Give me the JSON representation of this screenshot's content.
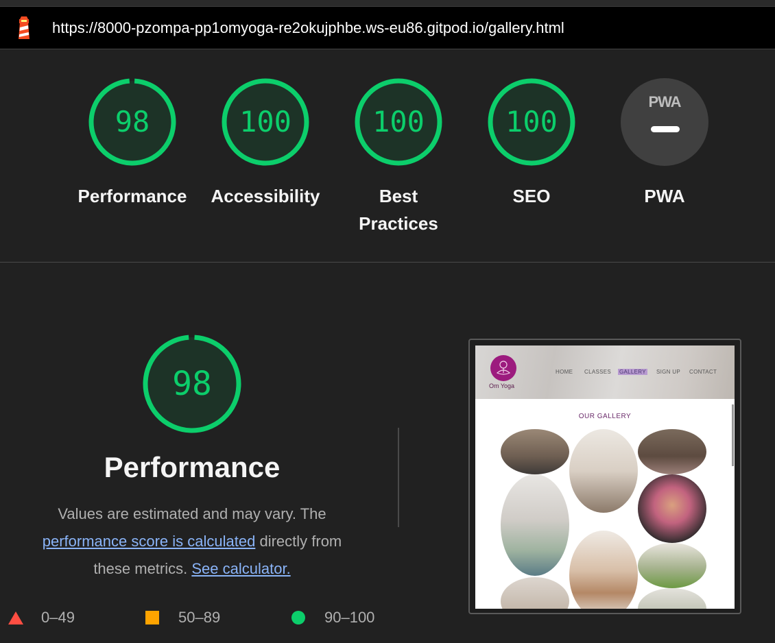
{
  "browser": {
    "url": "https://8000-pzompa-pp1omyoga-re2okujphbe.ws-eu86.gitpod.io/gallery.html"
  },
  "scores": [
    {
      "label": "Performance",
      "value": "98",
      "score": 0.98
    },
    {
      "label": "Accessibility",
      "value": "100",
      "score": 1.0
    },
    {
      "label": "Best Practices",
      "value": "100",
      "score": 1.0
    },
    {
      "label": "SEO",
      "value": "100",
      "score": 1.0
    }
  ],
  "pwa": {
    "label": "PWA",
    "badge_text": "PWA"
  },
  "performance_section": {
    "score": "98",
    "score_fraction": 0.98,
    "title": "Performance",
    "desc_part1": "Values are estimated and may vary. The",
    "desc_link1": "performance score is calculated",
    "desc_part2": "directly from",
    "desc_part3": "these metrics.",
    "desc_link2": "See calculator."
  },
  "legend": {
    "fail": "0–49",
    "average": "50–89",
    "pass": "90–100"
  },
  "thumbnail": {
    "logo_text": "Om Yoga",
    "nav": [
      "HOME",
      "CLASSES",
      "GALLERY",
      "SIGN UP",
      "CONTACT"
    ],
    "active_nav": "GALLERY",
    "gallery_title": "OUR GALLERY"
  },
  "colors": {
    "pass": "#0cce6b",
    "average": "#ffa400",
    "fail": "#ff4e42",
    "link": "#8ab4f8",
    "background": "#212121"
  }
}
